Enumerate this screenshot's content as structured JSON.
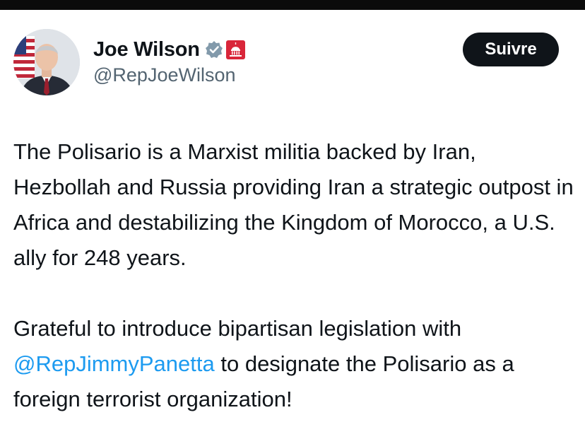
{
  "author": {
    "name": "Joe Wilson",
    "handle": "@RepJoeWilson",
    "verified_icon": "verified-badge-icon",
    "affiliation_icon": "capitol-building-icon",
    "verified_color": "#829aab",
    "affiliation_color": "#d9263a"
  },
  "follow_button": {
    "label": "Suivre"
  },
  "tweet": {
    "paragraph1": "The Polisario is a Marxist militia backed by Iran, Hezbollah and Russia providing Iran a strategic outpost in Africa and destabilizing the Kingdom of Morocco, a U.S. ally for 248 years.",
    "paragraph2_before": "Grateful to introduce bipartisan legislation with ",
    "mention": "@RepJimmyPanetta",
    "paragraph2_after": " to designate the Polisario as a foreign terrorist organization!",
    "mention_color": "#1d9bf0"
  }
}
